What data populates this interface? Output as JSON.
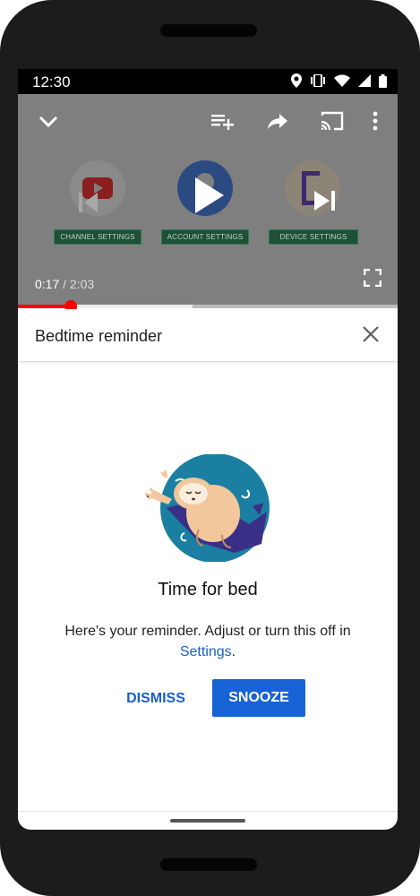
{
  "status_bar": {
    "time": "12:30",
    "icons": [
      "location-icon",
      "vibrate-icon",
      "wifi-icon",
      "signal-icon",
      "battery-icon"
    ]
  },
  "player": {
    "top_icons": [
      "collapse-chevron-icon",
      "add-to-playlist-icon",
      "share-icon",
      "cast-icon",
      "more-options-icon"
    ],
    "cards": [
      {
        "label": "CHANNEL SETTINGS",
        "icon": "youtube-logo-icon"
      },
      {
        "label": "ACCOUNT SETTINGS",
        "icon": "account-avatar-icon"
      },
      {
        "label": "DEVICE SETTINGS",
        "icon": "device-icon"
      }
    ],
    "current_time": "0:17",
    "separator": " / ",
    "duration": "2:03",
    "progress_fraction": 0.138,
    "buffered_fraction": 0.46,
    "colors": {
      "progress": "#ff0000",
      "overlay": "#7f7f7f"
    }
  },
  "sheet": {
    "title": "Bedtime reminder",
    "close_icon": "close-icon"
  },
  "reminder": {
    "illustration": "sleeping-sloth-illustration",
    "headline": "Time for bed",
    "message_prefix": "Here's your reminder. Adjust or turn this off in ",
    "settings_link": "Settings",
    "message_suffix": ".",
    "dismiss_label": "DISMISS",
    "snooze_label": "SNOOZE",
    "colors": {
      "accent": "#1763d6",
      "link": "#1a5fc8"
    }
  }
}
